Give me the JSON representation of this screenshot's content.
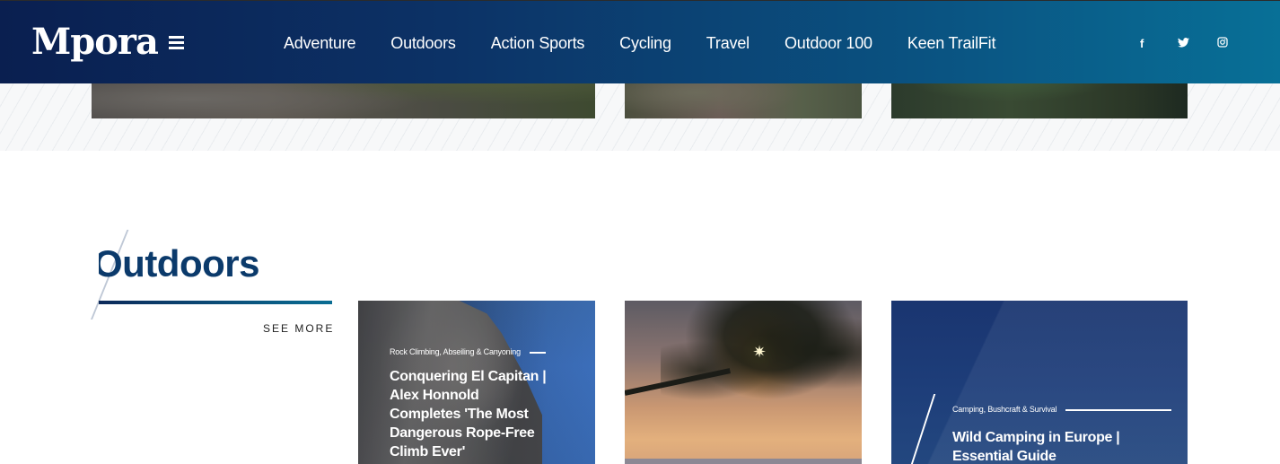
{
  "header": {
    "logo": "Mpora",
    "nav": [
      "Adventure",
      "Outdoors",
      "Action Sports",
      "Cycling",
      "Travel",
      "Outdoor 100",
      "Keen TrailFit"
    ],
    "social": {
      "facebook": "f",
      "twitter": "🐦",
      "instagram": "◎"
    }
  },
  "section": {
    "title": "Outdoors",
    "see_more": "SEE MORE"
  },
  "cards": [
    {
      "category": "Rock Climbing, Abseiling & Canyoning",
      "title": "Conquering El Capitan | Alex Honnold Completes 'The Most Dangerous Rope-Free Climb Ever'"
    },
    {
      "category": "",
      "title": ""
    },
    {
      "category": "Camping, Bushcraft & Survival",
      "title": "Wild Camping in Europe | Essential Guide"
    }
  ],
  "colors": {
    "header_start": "#0a1f50",
    "header_end": "#087097",
    "accent": "#0b3a6b"
  }
}
